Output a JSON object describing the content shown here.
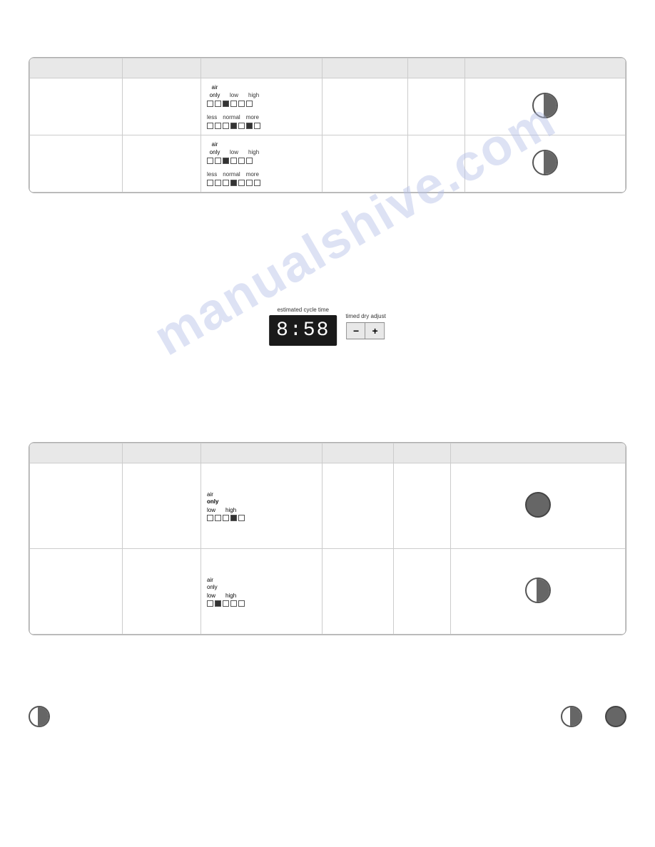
{
  "watermark": {
    "text": "manualshive.com"
  },
  "table1": {
    "headers": [
      "",
      "",
      "",
      "",
      "",
      ""
    ],
    "rows": [
      {
        "col1": "",
        "col2": "",
        "col3_label": "air only",
        "col3_dots_row1": [
          "empty",
          "empty",
          "filled",
          "empty",
          "empty",
          "empty"
        ],
        "col3_labels": [
          "low",
          "high",
          "less",
          "normal",
          "more"
        ],
        "col3_dots_row2": [
          "empty",
          "empty",
          "filled",
          "empty",
          "empty",
          "filled",
          "empty"
        ],
        "col4": "",
        "col5": "",
        "col6_circle": "half-right"
      },
      {
        "col1": "",
        "col2": "",
        "col3_label": "air only",
        "col3_dots_row1": [
          "empty",
          "empty",
          "filled",
          "empty",
          "empty",
          "empty"
        ],
        "col3_labels": [
          "low",
          "high",
          "less",
          "normal",
          "more"
        ],
        "col3_dots_row2": [
          "empty",
          "empty",
          "filled",
          "empty",
          "empty",
          "empty",
          "empty"
        ],
        "col4": "",
        "col5": "",
        "col6_circle": "half-right"
      }
    ]
  },
  "digital_display": {
    "label": "estimated cycle time",
    "value": "8:58",
    "timed_label": "timed dry adjust",
    "minus_label": "−",
    "plus_label": "+"
  },
  "table2": {
    "headers": [
      "",
      "",
      "",
      "",
      "",
      ""
    ],
    "rows": [
      {
        "col1": "",
        "col2": "",
        "fan_label": "air",
        "fan_sublabel": "only",
        "fan_dots": [
          "empty",
          "empty",
          "empty",
          "filled",
          "empty"
        ],
        "fan_labels": [
          "low",
          "high"
        ],
        "col4": "",
        "col5": "",
        "col6_circle": "half-dark"
      },
      {
        "col1": "",
        "col2": "",
        "fan_label": "air",
        "fan_sublabel": "only",
        "fan_dots": [
          "empty",
          "filled",
          "empty",
          "empty",
          "empty"
        ],
        "fan_labels": [
          "low",
          "high"
        ],
        "col4": "",
        "col5": "",
        "col6_circle": "half-right"
      }
    ]
  },
  "legend": {
    "items": [
      {
        "circle": "half-right",
        "label": ""
      },
      {
        "circle": "half-dark",
        "label": ""
      }
    ]
  }
}
